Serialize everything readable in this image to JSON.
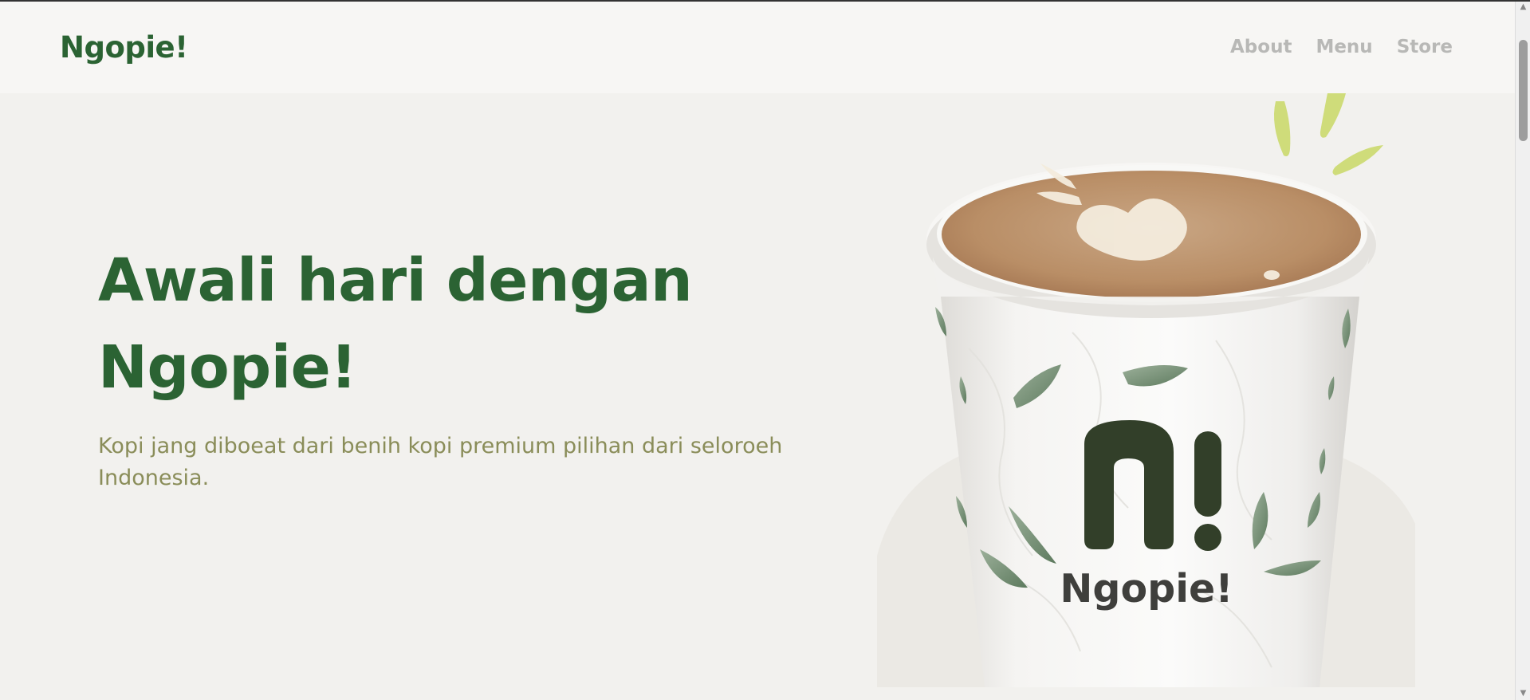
{
  "nav": {
    "brand": "Ngopie!",
    "links": [
      "About",
      "Menu",
      "Store"
    ]
  },
  "hero": {
    "title_line1": "Awali hari dengan",
    "title_line2": "Ngopie!",
    "subtitle": "Kopi jang diboeat dari benih kopi premium pilihan dari seloroeh Indonesia."
  },
  "product_image": {
    "cup_brand": "Ngopie!",
    "cup_logo": "n!"
  },
  "colors": {
    "brand_green": "#2b6333",
    "subtitle_olive": "#8a8d59",
    "nav_link_gray": "#b8b8b6",
    "background": "#f2f1ee",
    "navbar_bg": "#f7f6f4",
    "accent_lime": "#cfdc7a",
    "cup_logo_dark": "#323f29"
  },
  "scrollbar": {
    "up_icon": "triangle-up-icon",
    "down_icon": "triangle-down-icon"
  }
}
